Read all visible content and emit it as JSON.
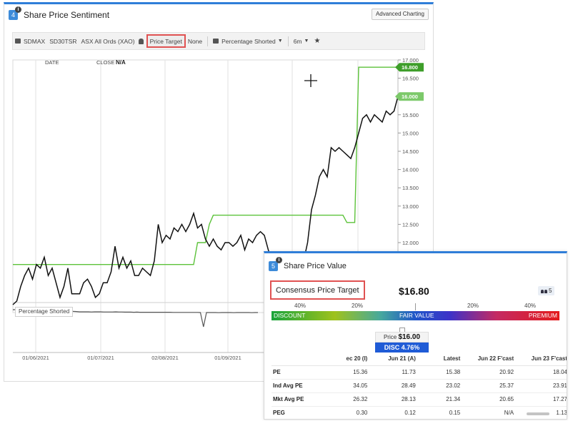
{
  "sentiment_panel": {
    "number": "4",
    "info_icon": "i",
    "title": "Share Price Sentiment",
    "advanced_button": "Advanced Charting",
    "toolbar": {
      "ticker": "SDMAX",
      "compare1": "SD30TSR",
      "compare2": "ASX All Ords (XAO)",
      "price_target": "Price Target",
      "none": "None",
      "indicator": "Percentage Shorted",
      "period": "6m"
    },
    "readout": {
      "date_label": "DATE",
      "close_label": "CLOSE",
      "close_value": "N/A"
    },
    "subchart_label": "Percentage Shorted",
    "price_badges": {
      "target": "16.800",
      "last": "16.000"
    },
    "colors": {
      "price_line": "#111111",
      "target_line": "#5cc23a",
      "badge_target": "#3e9e2a",
      "badge_last": "#7cc96a",
      "accent": "#2f7ed8"
    }
  },
  "chart_data": {
    "type": "line",
    "x_labels": [
      "01/06/2021",
      "01/07/2021",
      "02/08/2021",
      "01/09/2021"
    ],
    "y_ticks": [
      "17.000",
      "16.500",
      "16.000",
      "15.500",
      "15.000",
      "14.500",
      "14.000",
      "13.500",
      "13.000",
      "12.500",
      "12.000"
    ],
    "ylim": [
      12.0,
      17.0
    ],
    "series": [
      {
        "name": "SDMAX",
        "values": [
          10.3,
          10.4,
          10.8,
          11.1,
          11.3,
          11.0,
          11.4,
          11.3,
          11.6,
          11.1,
          11.3,
          10.9,
          10.5,
          10.8,
          11.3,
          10.6,
          10.6,
          10.6,
          10.9,
          11.0,
          10.8,
          10.5,
          10.6,
          10.9,
          10.9,
          11.2,
          11.9,
          11.3,
          11.6,
          11.3,
          11.5,
          11.1,
          11.1,
          11.3,
          11.2,
          11.1,
          11.5,
          12.5,
          12.0,
          12.2,
          12.1,
          12.4,
          12.3,
          12.5,
          12.3,
          12.5,
          12.8,
          12.4,
          12.5,
          12.1,
          11.9,
          12.1,
          11.9,
          11.8,
          12.0,
          12.0,
          11.9,
          12.0,
          12.2,
          11.8,
          12.1,
          12.0,
          12.2,
          12.3,
          12.2,
          11.8,
          11.5,
          11.3,
          11.5,
          11.7,
          11.5,
          11.6,
          11.4,
          11.3,
          11.5,
          12.0,
          12.9,
          13.3,
          13.8,
          14.0,
          13.8,
          14.6,
          14.5,
          14.6,
          14.5,
          14.4,
          14.3,
          14.6,
          15.0,
          15.4,
          15.5,
          15.3,
          15.5,
          15.4,
          15.3,
          15.6,
          15.5,
          15.6,
          16.0
        ]
      },
      {
        "name": "Price Target",
        "values": [
          11.4,
          11.4,
          11.4,
          11.4,
          11.4,
          11.4,
          11.4,
          11.4,
          11.4,
          11.4,
          11.4,
          11.4,
          11.4,
          11.4,
          11.4,
          11.4,
          11.4,
          11.4,
          11.4,
          11.4,
          11.4,
          11.4,
          11.4,
          11.4,
          11.4,
          11.4,
          11.4,
          11.4,
          11.4,
          11.4,
          11.4,
          11.4,
          11.4,
          11.4,
          11.4,
          11.4,
          11.4,
          11.4,
          11.4,
          11.4,
          11.4,
          11.4,
          11.4,
          11.4,
          11.4,
          11.4,
          11.4,
          12.0,
          12.0,
          12.0,
          12.5,
          12.75,
          12.75,
          12.75,
          12.75,
          12.75,
          12.75,
          12.75,
          12.75,
          12.75,
          12.75,
          12.75,
          12.75,
          12.75,
          12.75,
          12.75,
          12.75,
          12.75,
          12.75,
          12.75,
          12.75,
          12.75,
          12.75,
          12.75,
          12.75,
          12.75,
          12.75,
          12.75,
          12.75,
          12.75,
          12.75,
          12.75,
          12.75,
          12.75,
          12.75,
          12.55,
          12.55,
          12.55,
          16.8,
          16.8,
          16.8,
          16.8,
          16.8,
          16.8,
          16.8,
          16.8,
          16.8,
          16.8,
          16.8
        ]
      }
    ],
    "sub_series": {
      "name": "Percentage Shorted",
      "values": [
        0.6,
        0.6,
        0.6,
        0.6,
        0.6,
        0.62,
        0.6,
        0.6,
        0.6,
        0.62,
        0.6,
        0.6,
        0.6,
        0.58,
        0.6,
        0.6,
        0.6,
        0.55,
        0.52,
        0.5,
        0.48,
        0.47,
        0.45,
        0.45,
        0.45,
        0.45,
        0.44,
        0.45,
        0.45,
        0.45,
        0.44,
        0.44,
        0.44,
        0.44,
        0.45,
        0.44,
        0.44,
        0.43,
        0.43,
        0.43,
        0.42,
        0.43,
        0.42,
        0.42,
        0.42,
        0.42,
        0.42,
        0.42,
        0.42,
        0.42,
        0.42,
        0.42,
        0.42,
        0.41,
        0.41,
        0.41,
        0.41,
        0.41,
        0.41,
        0.41,
        0.41,
        0.41,
        0.4,
        -0.6,
        0.4,
        0.4,
        0.4,
        0.4,
        0.39,
        0.4,
        0.4,
        0.4,
        0.4,
        0.39,
        0.4,
        0.4,
        0.4,
        0.4,
        0.4,
        0.39,
        0.4,
        0.4
      ]
    }
  },
  "value_panel": {
    "number": "5",
    "info_icon": "i",
    "title": "Share Price Value",
    "consensus_label": "Consensus Price Target",
    "consensus_value": "$16.80",
    "analysts": "5",
    "scale_pcts": [
      "40%",
      "20%",
      "20%",
      "40%"
    ],
    "scale_labels": {
      "left": "DISCOUNT",
      "center": "FAIR VALUE",
      "right": "PREMIUM"
    },
    "price_label": "Price",
    "price_value": "$16.00",
    "disc_label": "DISC 4.76%",
    "table": {
      "headers": [
        "",
        "ec 20 (I)",
        "Jun 21 (A)",
        "Latest",
        "Jun 22 F'cast",
        "Jun 23 F'cast"
      ],
      "rows": [
        {
          "label": "PE",
          "values": [
            "15.36",
            "11.73",
            "15.38",
            "20.92",
            "18.04"
          ]
        },
        {
          "label": "Ind Avg PE",
          "values": [
            "34.05",
            "28.49",
            "23.02",
            "25.37",
            "23.91"
          ]
        },
        {
          "label": "Mkt Avg PE",
          "values": [
            "26.32",
            "28.13",
            "21.34",
            "20.65",
            "17.27"
          ]
        },
        {
          "label": "PEG",
          "values": [
            "0.30",
            "0.12",
            "0.15",
            "N/A",
            "1.13"
          ]
        }
      ]
    }
  }
}
